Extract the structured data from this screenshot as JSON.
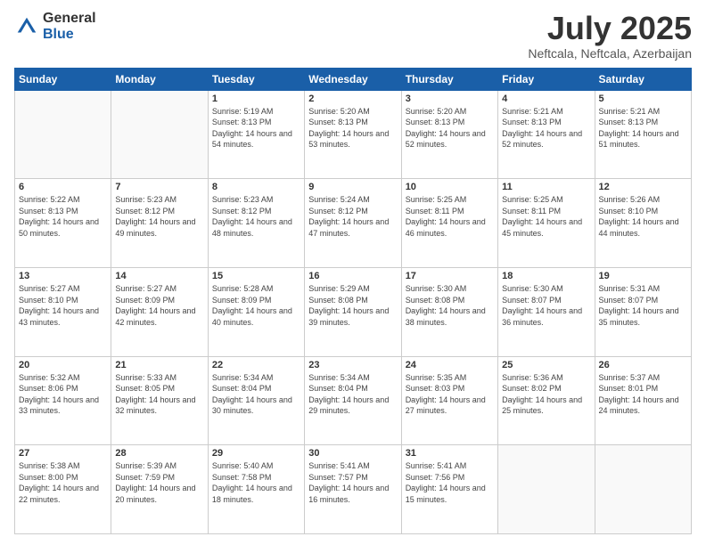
{
  "logo": {
    "general": "General",
    "blue": "Blue"
  },
  "title": "July 2025",
  "location": "Neftcala, Neftcala, Azerbaijan",
  "days_of_week": [
    "Sunday",
    "Monday",
    "Tuesday",
    "Wednesday",
    "Thursday",
    "Friday",
    "Saturday"
  ],
  "weeks": [
    [
      {
        "day": "",
        "sunrise": "",
        "sunset": "",
        "daylight": ""
      },
      {
        "day": "",
        "sunrise": "",
        "sunset": "",
        "daylight": ""
      },
      {
        "day": "1",
        "sunrise": "Sunrise: 5:19 AM",
        "sunset": "Sunset: 8:13 PM",
        "daylight": "Daylight: 14 hours and 54 minutes."
      },
      {
        "day": "2",
        "sunrise": "Sunrise: 5:20 AM",
        "sunset": "Sunset: 8:13 PM",
        "daylight": "Daylight: 14 hours and 53 minutes."
      },
      {
        "day": "3",
        "sunrise": "Sunrise: 5:20 AM",
        "sunset": "Sunset: 8:13 PM",
        "daylight": "Daylight: 14 hours and 52 minutes."
      },
      {
        "day": "4",
        "sunrise": "Sunrise: 5:21 AM",
        "sunset": "Sunset: 8:13 PM",
        "daylight": "Daylight: 14 hours and 52 minutes."
      },
      {
        "day": "5",
        "sunrise": "Sunrise: 5:21 AM",
        "sunset": "Sunset: 8:13 PM",
        "daylight": "Daylight: 14 hours and 51 minutes."
      }
    ],
    [
      {
        "day": "6",
        "sunrise": "Sunrise: 5:22 AM",
        "sunset": "Sunset: 8:13 PM",
        "daylight": "Daylight: 14 hours and 50 minutes."
      },
      {
        "day": "7",
        "sunrise": "Sunrise: 5:23 AM",
        "sunset": "Sunset: 8:12 PM",
        "daylight": "Daylight: 14 hours and 49 minutes."
      },
      {
        "day": "8",
        "sunrise": "Sunrise: 5:23 AM",
        "sunset": "Sunset: 8:12 PM",
        "daylight": "Daylight: 14 hours and 48 minutes."
      },
      {
        "day": "9",
        "sunrise": "Sunrise: 5:24 AM",
        "sunset": "Sunset: 8:12 PM",
        "daylight": "Daylight: 14 hours and 47 minutes."
      },
      {
        "day": "10",
        "sunrise": "Sunrise: 5:25 AM",
        "sunset": "Sunset: 8:11 PM",
        "daylight": "Daylight: 14 hours and 46 minutes."
      },
      {
        "day": "11",
        "sunrise": "Sunrise: 5:25 AM",
        "sunset": "Sunset: 8:11 PM",
        "daylight": "Daylight: 14 hours and 45 minutes."
      },
      {
        "day": "12",
        "sunrise": "Sunrise: 5:26 AM",
        "sunset": "Sunset: 8:10 PM",
        "daylight": "Daylight: 14 hours and 44 minutes."
      }
    ],
    [
      {
        "day": "13",
        "sunrise": "Sunrise: 5:27 AM",
        "sunset": "Sunset: 8:10 PM",
        "daylight": "Daylight: 14 hours and 43 minutes."
      },
      {
        "day": "14",
        "sunrise": "Sunrise: 5:27 AM",
        "sunset": "Sunset: 8:09 PM",
        "daylight": "Daylight: 14 hours and 42 minutes."
      },
      {
        "day": "15",
        "sunrise": "Sunrise: 5:28 AM",
        "sunset": "Sunset: 8:09 PM",
        "daylight": "Daylight: 14 hours and 40 minutes."
      },
      {
        "day": "16",
        "sunrise": "Sunrise: 5:29 AM",
        "sunset": "Sunset: 8:08 PM",
        "daylight": "Daylight: 14 hours and 39 minutes."
      },
      {
        "day": "17",
        "sunrise": "Sunrise: 5:30 AM",
        "sunset": "Sunset: 8:08 PM",
        "daylight": "Daylight: 14 hours and 38 minutes."
      },
      {
        "day": "18",
        "sunrise": "Sunrise: 5:30 AM",
        "sunset": "Sunset: 8:07 PM",
        "daylight": "Daylight: 14 hours and 36 minutes."
      },
      {
        "day": "19",
        "sunrise": "Sunrise: 5:31 AM",
        "sunset": "Sunset: 8:07 PM",
        "daylight": "Daylight: 14 hours and 35 minutes."
      }
    ],
    [
      {
        "day": "20",
        "sunrise": "Sunrise: 5:32 AM",
        "sunset": "Sunset: 8:06 PM",
        "daylight": "Daylight: 14 hours and 33 minutes."
      },
      {
        "day": "21",
        "sunrise": "Sunrise: 5:33 AM",
        "sunset": "Sunset: 8:05 PM",
        "daylight": "Daylight: 14 hours and 32 minutes."
      },
      {
        "day": "22",
        "sunrise": "Sunrise: 5:34 AM",
        "sunset": "Sunset: 8:04 PM",
        "daylight": "Daylight: 14 hours and 30 minutes."
      },
      {
        "day": "23",
        "sunrise": "Sunrise: 5:34 AM",
        "sunset": "Sunset: 8:04 PM",
        "daylight": "Daylight: 14 hours and 29 minutes."
      },
      {
        "day": "24",
        "sunrise": "Sunrise: 5:35 AM",
        "sunset": "Sunset: 8:03 PM",
        "daylight": "Daylight: 14 hours and 27 minutes."
      },
      {
        "day": "25",
        "sunrise": "Sunrise: 5:36 AM",
        "sunset": "Sunset: 8:02 PM",
        "daylight": "Daylight: 14 hours and 25 minutes."
      },
      {
        "day": "26",
        "sunrise": "Sunrise: 5:37 AM",
        "sunset": "Sunset: 8:01 PM",
        "daylight": "Daylight: 14 hours and 24 minutes."
      }
    ],
    [
      {
        "day": "27",
        "sunrise": "Sunrise: 5:38 AM",
        "sunset": "Sunset: 8:00 PM",
        "daylight": "Daylight: 14 hours and 22 minutes."
      },
      {
        "day": "28",
        "sunrise": "Sunrise: 5:39 AM",
        "sunset": "Sunset: 7:59 PM",
        "daylight": "Daylight: 14 hours and 20 minutes."
      },
      {
        "day": "29",
        "sunrise": "Sunrise: 5:40 AM",
        "sunset": "Sunset: 7:58 PM",
        "daylight": "Daylight: 14 hours and 18 minutes."
      },
      {
        "day": "30",
        "sunrise": "Sunrise: 5:41 AM",
        "sunset": "Sunset: 7:57 PM",
        "daylight": "Daylight: 14 hours and 16 minutes."
      },
      {
        "day": "31",
        "sunrise": "Sunrise: 5:41 AM",
        "sunset": "Sunset: 7:56 PM",
        "daylight": "Daylight: 14 hours and 15 minutes."
      },
      {
        "day": "",
        "sunrise": "",
        "sunset": "",
        "daylight": ""
      },
      {
        "day": "",
        "sunrise": "",
        "sunset": "",
        "daylight": ""
      }
    ]
  ]
}
